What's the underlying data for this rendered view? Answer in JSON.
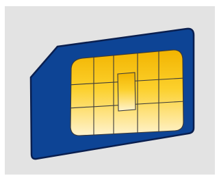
{
  "illustration": {
    "subject": "sim-card",
    "colors": {
      "background": "#e3e3e3",
      "card_blue": "#0d4495",
      "card_edge": "#0a1f4f",
      "chip_gold_top": "#f2b400",
      "chip_gold_mid": "#fcd02c",
      "chip_gold_bottom": "#fff3cf",
      "chip_lines": "#3a3a3a"
    }
  }
}
